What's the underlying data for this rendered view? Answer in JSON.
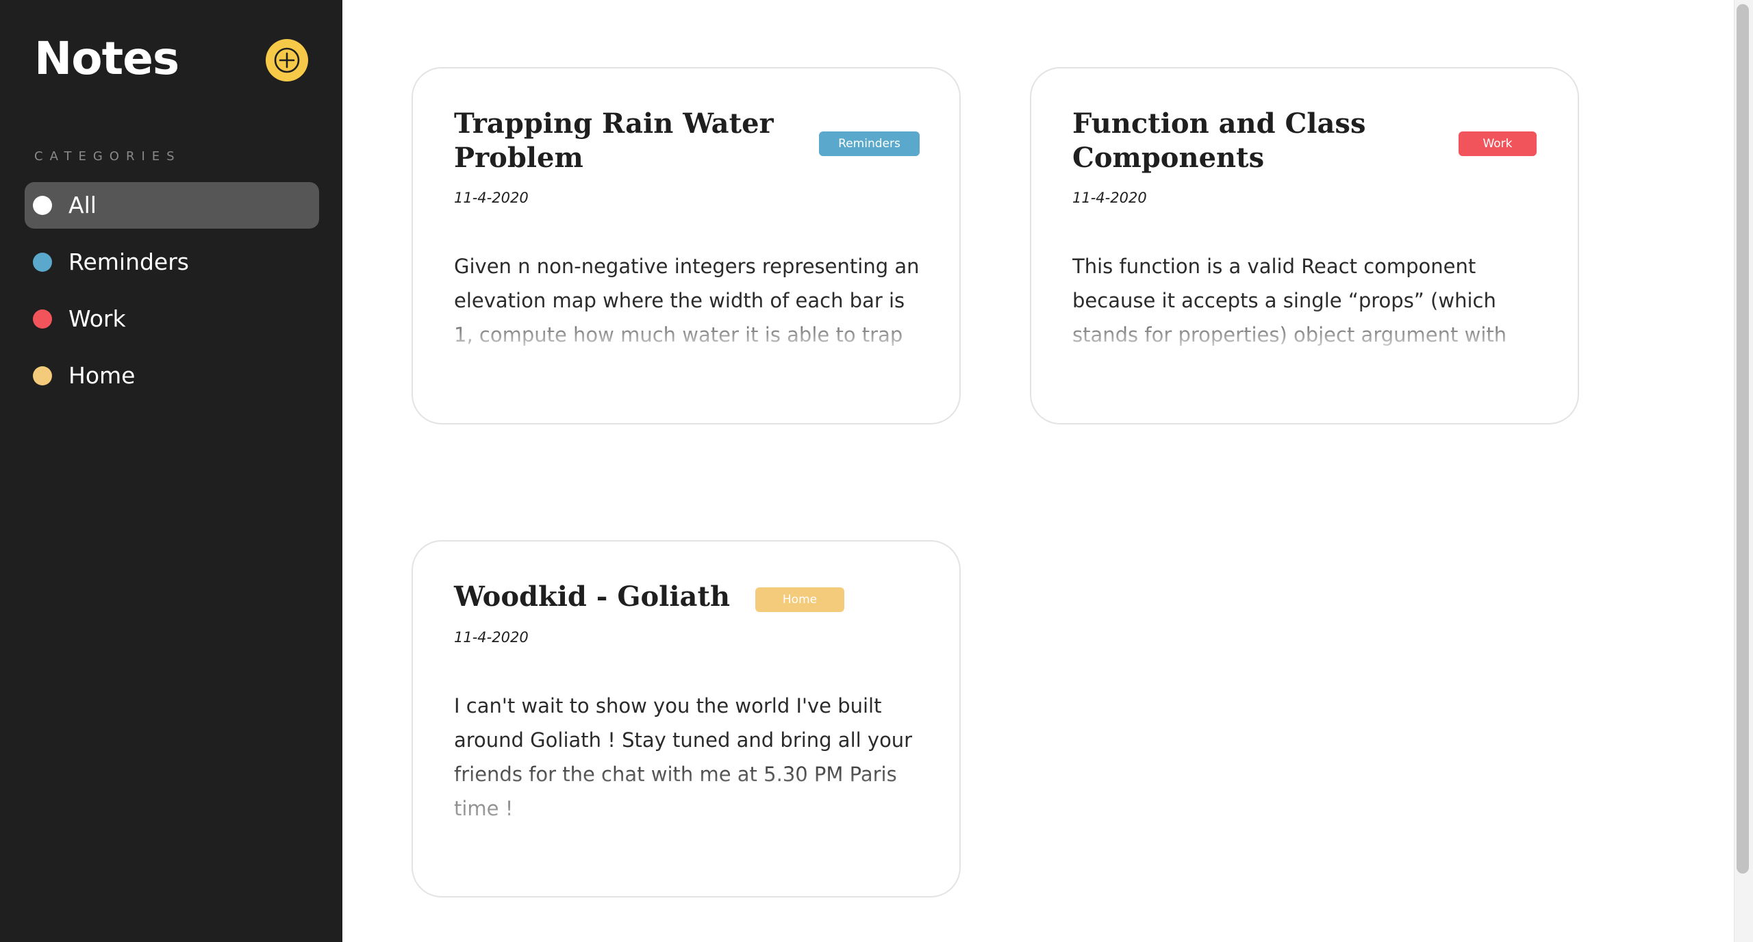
{
  "app": {
    "title": "Notes",
    "add_icon": "plus-icon",
    "accent_color": "#f7c948"
  },
  "sidebar": {
    "categories_heading": "CATEGORIES",
    "categories": [
      {
        "label": "All",
        "color": "#ffffff",
        "active": true
      },
      {
        "label": "Reminders",
        "color": "#5aa8cc",
        "active": false
      },
      {
        "label": "Work",
        "color": "#f2545b",
        "active": false
      },
      {
        "label": "Home",
        "color": "#f3cb7a",
        "active": false
      }
    ]
  },
  "notes": [
    {
      "title": "Trapping Rain Water Problem",
      "tag": "Reminders",
      "tag_color": "#5aa8cc",
      "date": "11-4-2020",
      "body": "Given n non-negative integers representing an elevation map where the width of each bar is 1, compute how much water it is able to trap after raining."
    },
    {
      "title": "Function and Class Components",
      "tag": "Work",
      "tag_color": "#f2545b",
      "date": "11-4-2020",
      "body": "This function is a valid React component because it accepts a single “props” (which stands for properties) object argument with data and returns a React element."
    },
    {
      "title": "Woodkid - Goliath",
      "tag": "Home",
      "tag_color": "#f3cb7a",
      "date": "11-4-2020",
      "body": "I can't wait to show you the world I've built around Goliath ! Stay tuned and bring all your friends for the chat with me at 5.30 PM Paris time !"
    }
  ]
}
